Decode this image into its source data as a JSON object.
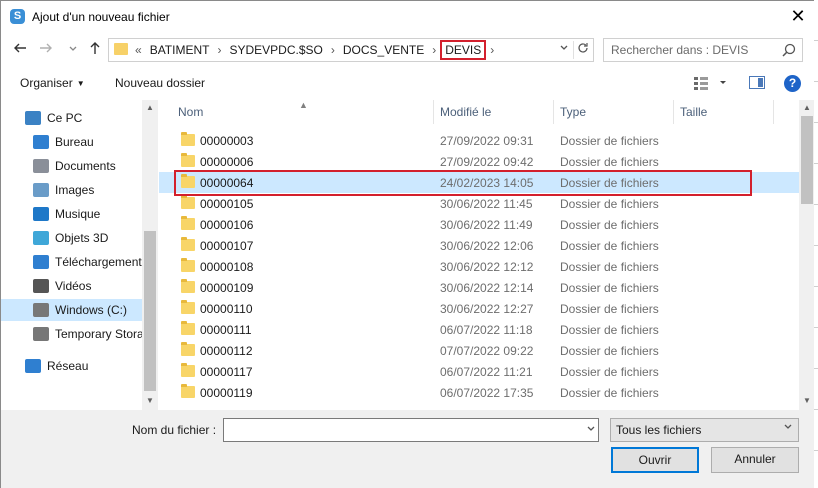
{
  "window": {
    "title": "Ajout d'un nouveau fichier",
    "app_icon": "S",
    "close_icon": "✕"
  },
  "nav": {
    "back_icon": "arrow-left-icon",
    "forward_icon": "arrow-right-icon",
    "recent_icon": "chevron-down-icon",
    "up_icon": "arrow-up-icon"
  },
  "address": {
    "overflow": "«",
    "crumbs": [
      "BATIMENT",
      "SYDEVPDC.$SO",
      "DOCS_VENTE",
      "DEVIS"
    ],
    "separator": "›",
    "highlighted_crumb": "DEVIS"
  },
  "search": {
    "placeholder": "Rechercher dans : DEVIS"
  },
  "toolbar": {
    "organiser": "Organiser",
    "new_folder": "Nouveau dossier",
    "help": "?"
  },
  "sidebar": {
    "items": [
      {
        "label": "Ce PC",
        "icon": "computer-icon",
        "indent": 1
      },
      {
        "label": "Bureau",
        "icon": "desktop-icon",
        "indent": 2
      },
      {
        "label": "Documents",
        "icon": "documents-icon",
        "indent": 2
      },
      {
        "label": "Images",
        "icon": "images-icon",
        "indent": 2
      },
      {
        "label": "Musique",
        "icon": "music-icon",
        "indent": 2
      },
      {
        "label": "Objets 3D",
        "icon": "objects-3d-icon",
        "indent": 2
      },
      {
        "label": "Téléchargements",
        "icon": "downloads-icon",
        "indent": 2
      },
      {
        "label": "Vidéos",
        "icon": "videos-icon",
        "indent": 2
      },
      {
        "label": "Windows (C:)",
        "icon": "drive-icon",
        "indent": 2,
        "selected": true
      },
      {
        "label": "Temporary Storage",
        "icon": "drive-icon",
        "indent": 2
      },
      {
        "label": "Réseau",
        "icon": "network-icon",
        "indent": 1
      }
    ]
  },
  "columns": {
    "name": "Nom",
    "modified": "Modifié le",
    "type": "Type",
    "size": "Taille"
  },
  "files": [
    {
      "name": "00000003",
      "modified": "27/09/2022 09:31",
      "type": "Dossier de fichiers"
    },
    {
      "name": "00000006",
      "modified": "27/09/2022 09:42",
      "type": "Dossier de fichiers"
    },
    {
      "name": "00000064",
      "modified": "24/02/2023 14:05",
      "type": "Dossier de fichiers",
      "selected": true
    },
    {
      "name": "00000105",
      "modified": "30/06/2022 11:45",
      "type": "Dossier de fichiers"
    },
    {
      "name": "00000106",
      "modified": "30/06/2022 11:49",
      "type": "Dossier de fichiers"
    },
    {
      "name": "00000107",
      "modified": "30/06/2022 12:06",
      "type": "Dossier de fichiers"
    },
    {
      "name": "00000108",
      "modified": "30/06/2022 12:12",
      "type": "Dossier de fichiers"
    },
    {
      "name": "00000109",
      "modified": "30/06/2022 12:14",
      "type": "Dossier de fichiers"
    },
    {
      "name": "00000110",
      "modified": "30/06/2022 12:27",
      "type": "Dossier de fichiers"
    },
    {
      "name": "00000111",
      "modified": "06/07/2022 11:18",
      "type": "Dossier de fichiers"
    },
    {
      "name": "00000112",
      "modified": "07/07/2022 09:22",
      "type": "Dossier de fichiers"
    },
    {
      "name": "00000117",
      "modified": "06/07/2022 11:21",
      "type": "Dossier de fichiers"
    },
    {
      "name": "00000119",
      "modified": "06/07/2022 17:35",
      "type": "Dossier de fichiers"
    }
  ],
  "bottom": {
    "filename_label": "Nom du fichier :",
    "filename_value": "",
    "filter_value": "Tous les fichiers",
    "open_button": "Ouvrir",
    "cancel_button": "Annuler"
  },
  "colors": {
    "highlight_red": "#d3202d",
    "selection_blue": "#cce8ff",
    "folder_yellow": "#f8d568",
    "accent_blue": "#0078d7"
  }
}
